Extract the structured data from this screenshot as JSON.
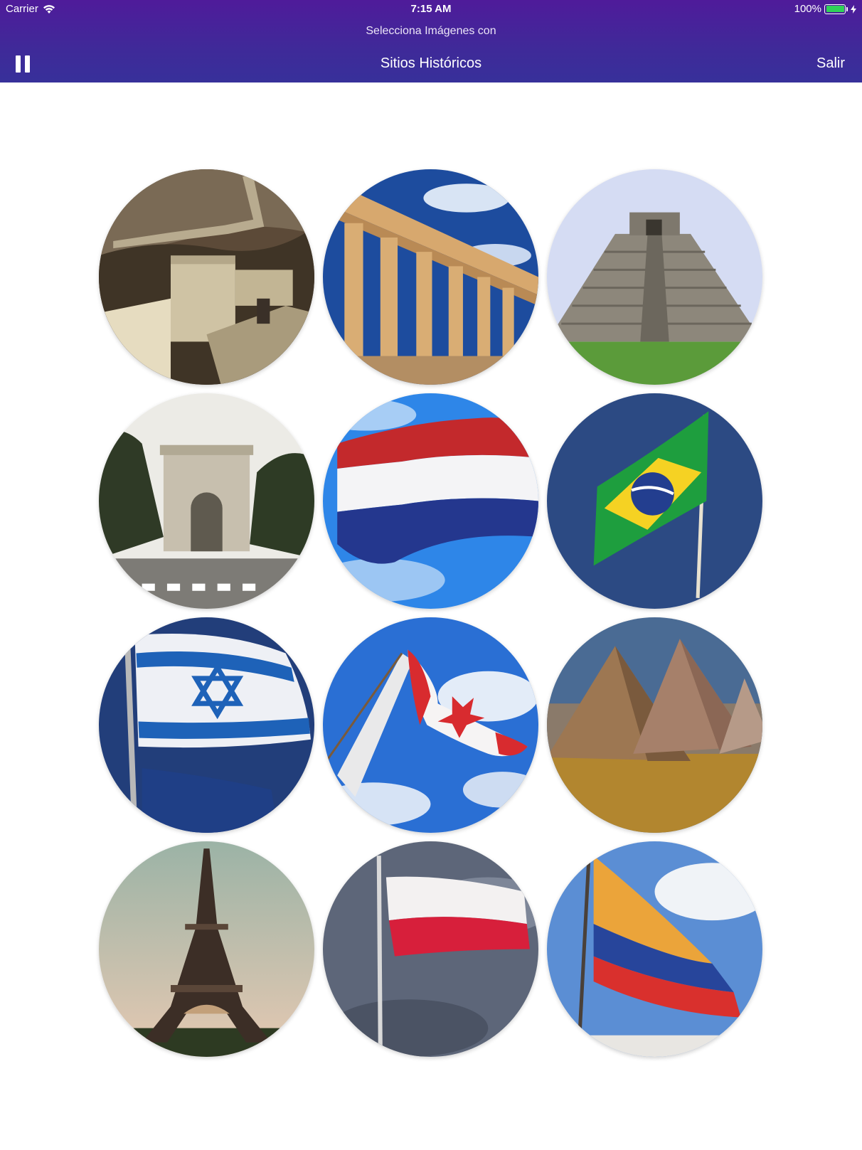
{
  "status_bar": {
    "carrier": "Carrier",
    "time": "7:15 AM",
    "battery_percent": "100%",
    "battery_level": 1.0
  },
  "header": {
    "subtitle": "Selecciona Imágenes con",
    "title": "Sitios Históricos",
    "exit_label": "Salir",
    "pause_icon": "pause-icon",
    "background_color": "#4a1fa0"
  },
  "tiles": [
    {
      "subject": "great-wall"
    },
    {
      "subject": "parthenon"
    },
    {
      "subject": "chichen-itza-pyramid"
    },
    {
      "subject": "arc-de-triomphe"
    },
    {
      "subject": "netherlands-flag"
    },
    {
      "subject": "brazil-flag"
    },
    {
      "subject": "israel-flag"
    },
    {
      "subject": "canada-flag"
    },
    {
      "subject": "giza-pyramids"
    },
    {
      "subject": "eiffel-tower"
    },
    {
      "subject": "poland-flag"
    },
    {
      "subject": "colombia-flag"
    }
  ]
}
